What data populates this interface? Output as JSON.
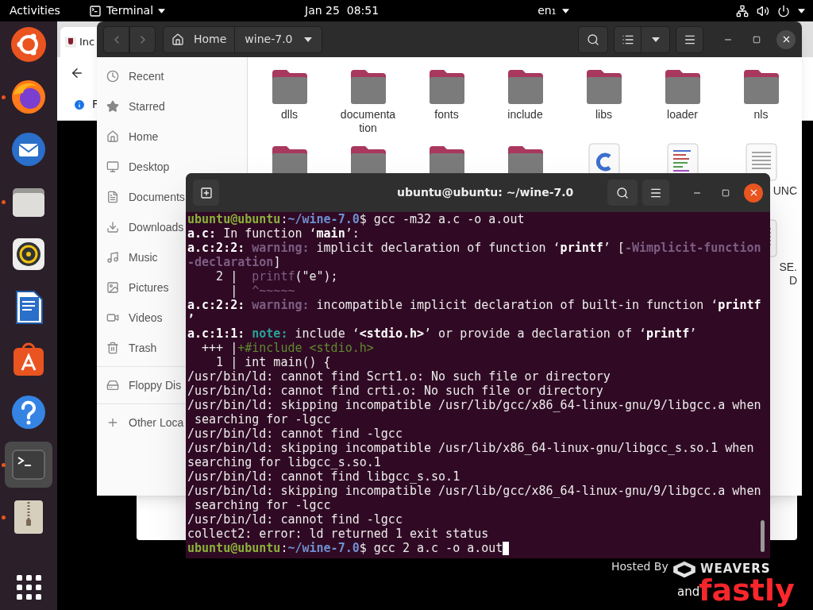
{
  "top_bar": {
    "activities": "Activities",
    "app_menu": "Terminal",
    "clock": "Jan 25  08:51",
    "input_source": "en₁"
  },
  "dock": [
    {
      "kind": "logo",
      "running": false,
      "selected": false
    },
    {
      "kind": "browser",
      "running": true,
      "selected": false
    },
    {
      "kind": "mail",
      "running": false,
      "selected": false
    },
    {
      "kind": "files",
      "running": true,
      "selected": false
    },
    {
      "kind": "music",
      "running": false,
      "selected": false
    },
    {
      "kind": "writer",
      "running": false,
      "selected": false
    },
    {
      "kind": "store",
      "running": false,
      "selected": false
    },
    {
      "kind": "help",
      "running": false,
      "selected": false
    },
    {
      "kind": "terminal",
      "running": true,
      "selected": true
    },
    {
      "kind": "archive",
      "running": true,
      "selected": false
    },
    {
      "kind": "apps",
      "running": false,
      "selected": false
    }
  ],
  "browser": {
    "tab": "Inc",
    "info": "F",
    "hosted_by": "Hosted By",
    "weavers": "WEAVERS",
    "and": "and",
    "fastly": "fastly"
  },
  "files": {
    "path": [
      "Home",
      "wine-7.0"
    ],
    "sidebar": [
      {
        "kind": "recent",
        "label": "Recent"
      },
      {
        "kind": "starred",
        "label": "Starred"
      },
      {
        "kind": "home",
        "label": "Home"
      },
      {
        "kind": "desktop",
        "label": "Desktop"
      },
      {
        "kind": "documents",
        "label": "Documents"
      },
      {
        "kind": "downloads",
        "label": "Downloads"
      },
      {
        "kind": "music",
        "label": "Music"
      },
      {
        "kind": "pictures",
        "label": "Pictures"
      },
      {
        "kind": "videos",
        "label": "Videos"
      },
      {
        "kind": "trash",
        "label": "Trash"
      },
      {
        "kind": "drive",
        "label": "Floppy Dis"
      },
      {
        "kind": "other",
        "label": "Other Loca"
      }
    ],
    "rows": [
      [
        {
          "kind": "folder",
          "label": "dlls"
        },
        {
          "kind": "folder",
          "label": "documentation"
        },
        {
          "kind": "folder",
          "label": "fonts"
        },
        {
          "kind": "folder",
          "label": "include"
        },
        {
          "kind": "folder",
          "label": "libs"
        },
        {
          "kind": "folder",
          "label": "loader"
        },
        {
          "kind": "folder",
          "label": "nls"
        }
      ],
      [
        {
          "kind": "folder"
        },
        {
          "kind": "folder"
        },
        {
          "kind": "folder"
        },
        {
          "kind": "folder"
        },
        {
          "kind": "c-source"
        },
        {
          "kind": "colored-text"
        },
        {
          "kind": "text",
          "label": "UNC"
        }
      ],
      [
        {
          "kind": "text",
          "label": "SE.\nD"
        }
      ]
    ]
  },
  "terminal": {
    "title": "ubuntu@ubuntu: ~/wine-7.0",
    "lines": [
      {
        "segments": [
          {
            "kind": "user",
            "text": "ubuntu@ubuntu"
          },
          {
            "kind": "plain",
            "text": ":"
          },
          {
            "kind": "path",
            "text": "~/wine-7.0"
          },
          {
            "kind": "plain",
            "text": "$ gcc -m32 a.c -o a.out"
          }
        ]
      },
      {
        "segments": [
          {
            "kind": "bold",
            "text": "a.c:"
          },
          {
            "kind": "plain",
            "text": " In function ‘"
          },
          {
            "kind": "bold",
            "text": "main"
          },
          {
            "kind": "plain",
            "text": "’:"
          }
        ]
      },
      {
        "segments": [
          {
            "kind": "bold",
            "text": "a.c:2:2: "
          },
          {
            "kind": "warning",
            "text": "warning:"
          },
          {
            "kind": "plain",
            "text": " implicit declaration of function ‘"
          },
          {
            "kind": "bold",
            "text": "printf"
          },
          {
            "kind": "plain",
            "text": "’ ["
          },
          {
            "kind": "warning",
            "text": "-Wimplicit-function"
          }
        ]
      },
      {
        "segments": [
          {
            "kind": "warning",
            "text": "-declaration"
          },
          {
            "kind": "plain",
            "text": "]"
          }
        ]
      },
      {
        "segments": [
          {
            "kind": "plain",
            "text": "    2 |  "
          },
          {
            "kind": "dim",
            "text": "printf"
          },
          {
            "kind": "plain",
            "text": "(\"e\");"
          }
        ]
      },
      {
        "segments": [
          {
            "kind": "plain",
            "text": "      |  "
          },
          {
            "kind": "dim",
            "text": "^~~~~~"
          }
        ]
      },
      {
        "segments": [
          {
            "kind": "bold",
            "text": "a.c:2:2: "
          },
          {
            "kind": "warning",
            "text": "warning:"
          },
          {
            "kind": "plain",
            "text": " incompatible implicit declaration of built-in function ‘"
          },
          {
            "kind": "bold",
            "text": "printf"
          }
        ]
      },
      {
        "segments": [
          {
            "kind": "bold",
            "text": "’"
          }
        ]
      },
      {
        "segments": [
          {
            "kind": "bold",
            "text": "a.c:1:1: "
          },
          {
            "kind": "note",
            "text": "note:"
          },
          {
            "kind": "plain",
            "text": " include ‘"
          },
          {
            "kind": "bold",
            "text": "<stdio.h>"
          },
          {
            "kind": "plain",
            "text": "’ or provide a declaration of ‘"
          },
          {
            "kind": "bold",
            "text": "printf"
          },
          {
            "kind": "plain",
            "text": "’"
          }
        ]
      },
      {
        "segments": [
          {
            "kind": "plain",
            "text": "  +++ |"
          },
          {
            "kind": "hint",
            "text": "+#include <stdio.h>"
          }
        ]
      },
      {
        "segments": [
          {
            "kind": "plain",
            "text": "    1 | int main() {"
          }
        ]
      },
      {
        "segments": [
          {
            "kind": "plain",
            "text": "/usr/bin/ld: cannot find Scrt1.o: No such file or directory"
          }
        ]
      },
      {
        "segments": [
          {
            "kind": "plain",
            "text": "/usr/bin/ld: cannot find crti.o: No such file or directory"
          }
        ]
      },
      {
        "segments": [
          {
            "kind": "plain",
            "text": "/usr/bin/ld: skipping incompatible /usr/lib/gcc/x86_64-linux-gnu/9/libgcc.a when"
          }
        ]
      },
      {
        "segments": [
          {
            "kind": "plain",
            "text": " searching for -lgcc"
          }
        ]
      },
      {
        "segments": [
          {
            "kind": "plain",
            "text": "/usr/bin/ld: cannot find -lgcc"
          }
        ]
      },
      {
        "segments": [
          {
            "kind": "plain",
            "text": "/usr/bin/ld: skipping incompatible /usr/lib/x86_64-linux-gnu/libgcc_s.so.1 when"
          }
        ]
      },
      {
        "segments": [
          {
            "kind": "plain",
            "text": "searching for libgcc_s.so.1"
          }
        ]
      },
      {
        "segments": [
          {
            "kind": "plain",
            "text": "/usr/bin/ld: cannot find libgcc_s.so.1"
          }
        ]
      },
      {
        "segments": [
          {
            "kind": "plain",
            "text": "/usr/bin/ld: skipping incompatible /usr/lib/gcc/x86_64-linux-gnu/9/libgcc.a when"
          }
        ]
      },
      {
        "segments": [
          {
            "kind": "plain",
            "text": " searching for -lgcc"
          }
        ]
      },
      {
        "segments": [
          {
            "kind": "plain",
            "text": "/usr/bin/ld: cannot find -lgcc"
          }
        ]
      },
      {
        "segments": [
          {
            "kind": "plain",
            "text": "collect2: error: ld returned 1 exit status"
          }
        ]
      },
      {
        "segments": [
          {
            "kind": "user",
            "text": "ubuntu@ubuntu"
          },
          {
            "kind": "plain",
            "text": ":"
          },
          {
            "kind": "path",
            "text": "~/wine-7.0"
          },
          {
            "kind": "plain",
            "text": "$ gcc 2 a.c -o a.out"
          }
        ],
        "cursor": true
      }
    ]
  }
}
